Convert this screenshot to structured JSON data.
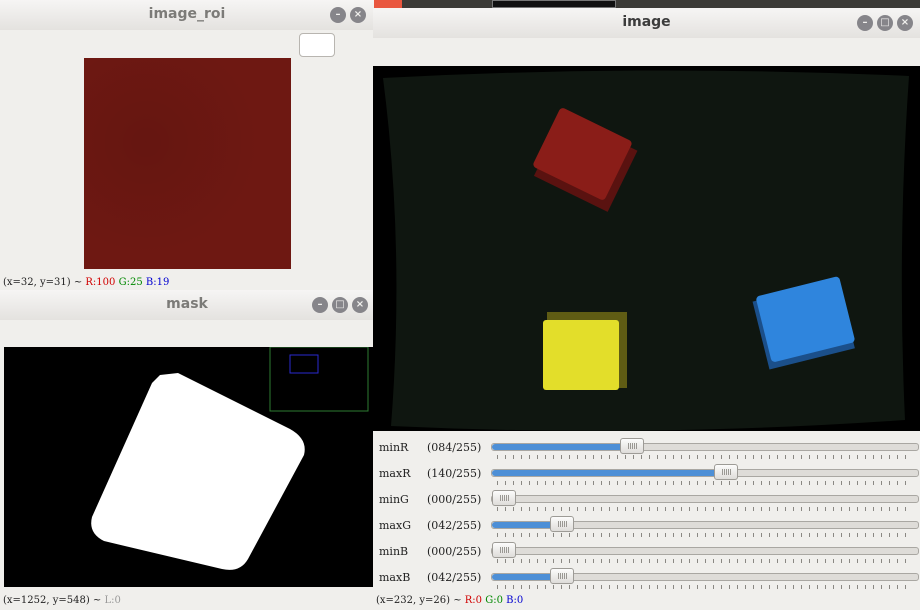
{
  "windows": {
    "roi": {
      "title": "image_roi",
      "status": {
        "coords": "(x=32, y=31) ~",
        "r": "R:100",
        "g": "G:25",
        "b": "B:19"
      },
      "colors": {
        "patch": "#6e1812"
      }
    },
    "mask": {
      "title": "mask",
      "status": {
        "coords": "(x=1252, y=548) ~",
        "l": "L:0"
      }
    },
    "image": {
      "title": "image",
      "status": {
        "coords": "(x=232, y=26) ~",
        "r": "R:0",
        "g": "G:0",
        "b": "B:0"
      },
      "colors": {
        "scene": "#0f1610",
        "red_block": "#8a1d18",
        "yellow_block": "#e3de2a",
        "blue_block": "#2f85dd"
      }
    }
  },
  "trackbars": [
    {
      "name": "minR",
      "value": "(084/255)",
      "fraction": 0.329
    },
    {
      "name": "maxR",
      "value": "(140/255)",
      "fraction": 0.549
    },
    {
      "name": "minG",
      "value": "(000/255)",
      "fraction": 0.0
    },
    {
      "name": "maxG",
      "value": "(042/255)",
      "fraction": 0.165
    },
    {
      "name": "minB",
      "value": "(000/255)",
      "fraction": 0.0
    },
    {
      "name": "maxB",
      "value": "(042/255)",
      "fraction": 0.165
    }
  ]
}
